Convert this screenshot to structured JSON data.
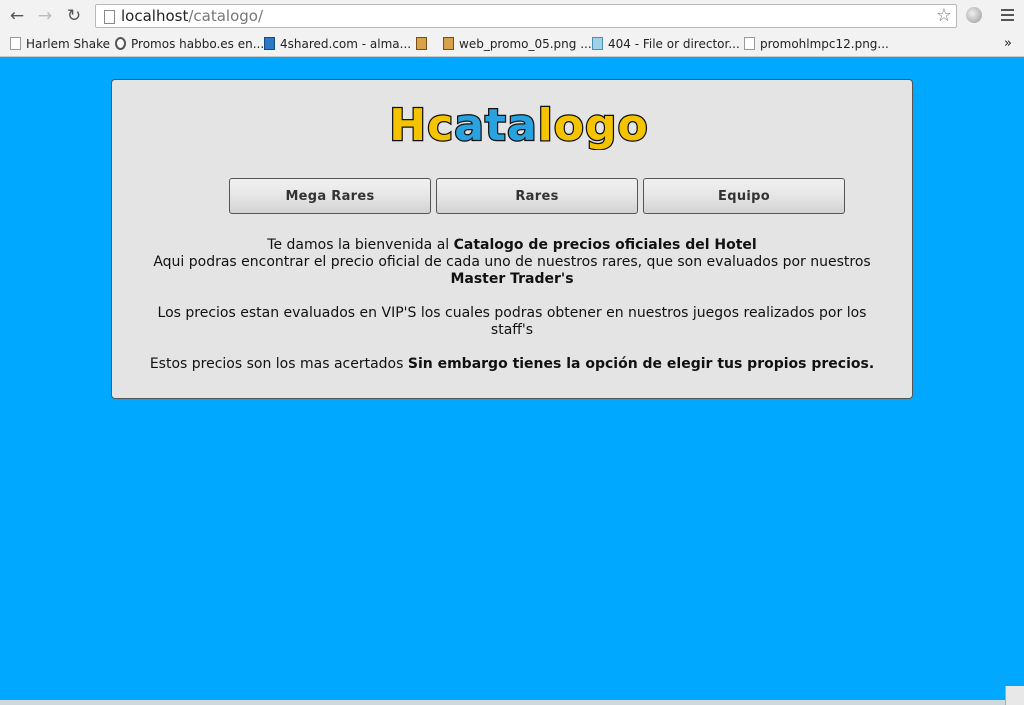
{
  "browser": {
    "url_host": "localhost",
    "url_path": "/catalogo/",
    "bookmarks": [
      {
        "label": "Harlem Shake",
        "icon": "page-icon"
      },
      {
        "label": "Promos habbo.es en...",
        "icon": "gear-icon"
      },
      {
        "label": "4shared.com - alma...",
        "icon": "4shared-icon"
      },
      {
        "label": "",
        "icon": "box-icon"
      },
      {
        "label": "web_promo_05.png ...",
        "icon": "box-icon"
      },
      {
        "label": "404 - File or director...",
        "icon": "globe-icon"
      },
      {
        "label": "promohlmpc12.png...",
        "icon": "page-icon"
      }
    ],
    "more_label": "»"
  },
  "page": {
    "logo_text": "Hcatalogo",
    "nav": [
      "Mega Rares",
      "Rares",
      "Equipo"
    ],
    "welcome_prefix": "Te damos la bienvenida al ",
    "welcome_bold": "Catalogo de precios oficiales del Hotel",
    "line2": "Aqui podras encontrar el precio oficial de cada uno de nuestros rares, que son evaluados por nuestros",
    "line2_bold": "Master Trader's",
    "para2": "Los precios estan evaluados en VIP'S los cuales podras obtener en nuestros juegos realizados por los staff's",
    "para3_prefix": "Estos precios son los mas acertados ",
    "para3_bold": "Sin embargo tienes la opción de elegir tus propios precios."
  },
  "colors": {
    "page_bg": "#00a8ff",
    "panel_bg": "#e4e4e4",
    "logo_fill": "#f5c400",
    "logo_accent": "#29a3e0"
  }
}
